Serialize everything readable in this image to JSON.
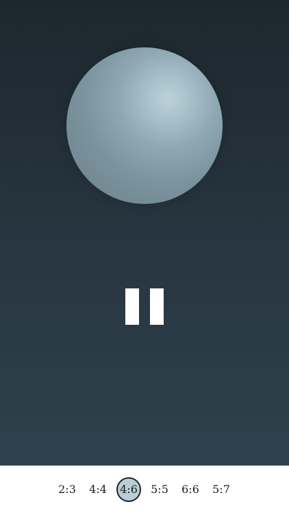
{
  "player": {
    "state": "playing",
    "pause_icon": "pause-icon"
  },
  "colors": {
    "background_top": "#1d272e",
    "background_bottom": "#2f414d",
    "orb": "#8ea7b2",
    "orb_highlight": "#bcd2db",
    "selected_ratio": "#b9cdd6"
  },
  "ratios": {
    "options": [
      "2:3",
      "4:4",
      "4:6",
      "5:5",
      "6:6",
      "5:7"
    ],
    "selected": "4:6"
  }
}
